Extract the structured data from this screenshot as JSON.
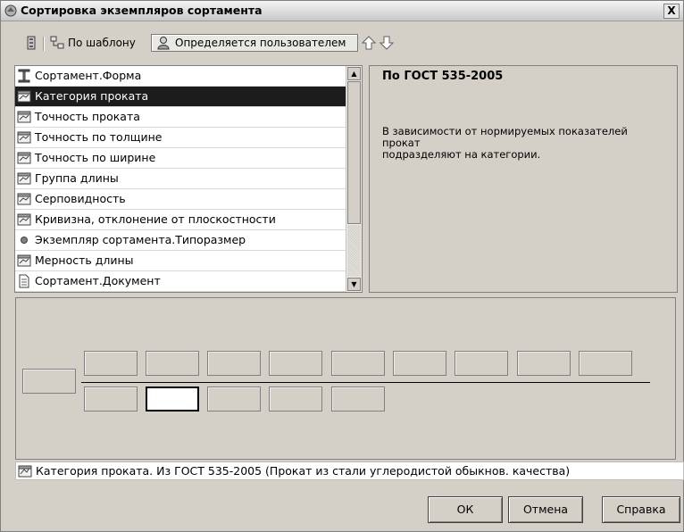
{
  "window": {
    "title": "Сортировка экземпляров сортамента",
    "close_label": "X"
  },
  "toolbar": {
    "template_label": "По шаблону",
    "user_label": "Определяется пользователем"
  },
  "list": {
    "items": [
      {
        "label": "Сортамент.Форма",
        "icon": "beam-icon",
        "selected": false
      },
      {
        "label": "Категория проката",
        "icon": "property-icon",
        "selected": true
      },
      {
        "label": "Точность проката",
        "icon": "property-icon",
        "selected": false
      },
      {
        "label": "Точность по толщине",
        "icon": "property-icon",
        "selected": false
      },
      {
        "label": "Точность по ширине",
        "icon": "property-icon",
        "selected": false
      },
      {
        "label": "Группа длины",
        "icon": "property-icon",
        "selected": false
      },
      {
        "label": "Серповидность",
        "icon": "property-icon",
        "selected": false
      },
      {
        "label": "Кривизна, отклонение от плоскостности",
        "icon": "property-icon",
        "selected": false
      },
      {
        "label": "Экземпляр сортамента.Типоразмер",
        "icon": "dot-icon",
        "selected": false
      },
      {
        "label": "Мерность длины",
        "icon": "property-icon",
        "selected": false
      },
      {
        "label": "Сортамент.Документ",
        "icon": "document-icon",
        "selected": false
      }
    ]
  },
  "info": {
    "header": "По ГОСТ 535-2005",
    "line1": "В зависимости от нормируемых показателей",
    "line2": "прокат",
    "line3": "подразделяют на категории."
  },
  "status": {
    "text": "Категория проката. Из ГОСТ 535-2005 (Прокат из стали углеродистой обыкнов. качества)"
  },
  "buttons": {
    "ok": "ОК",
    "cancel": "Отмена",
    "help": "Справка"
  }
}
